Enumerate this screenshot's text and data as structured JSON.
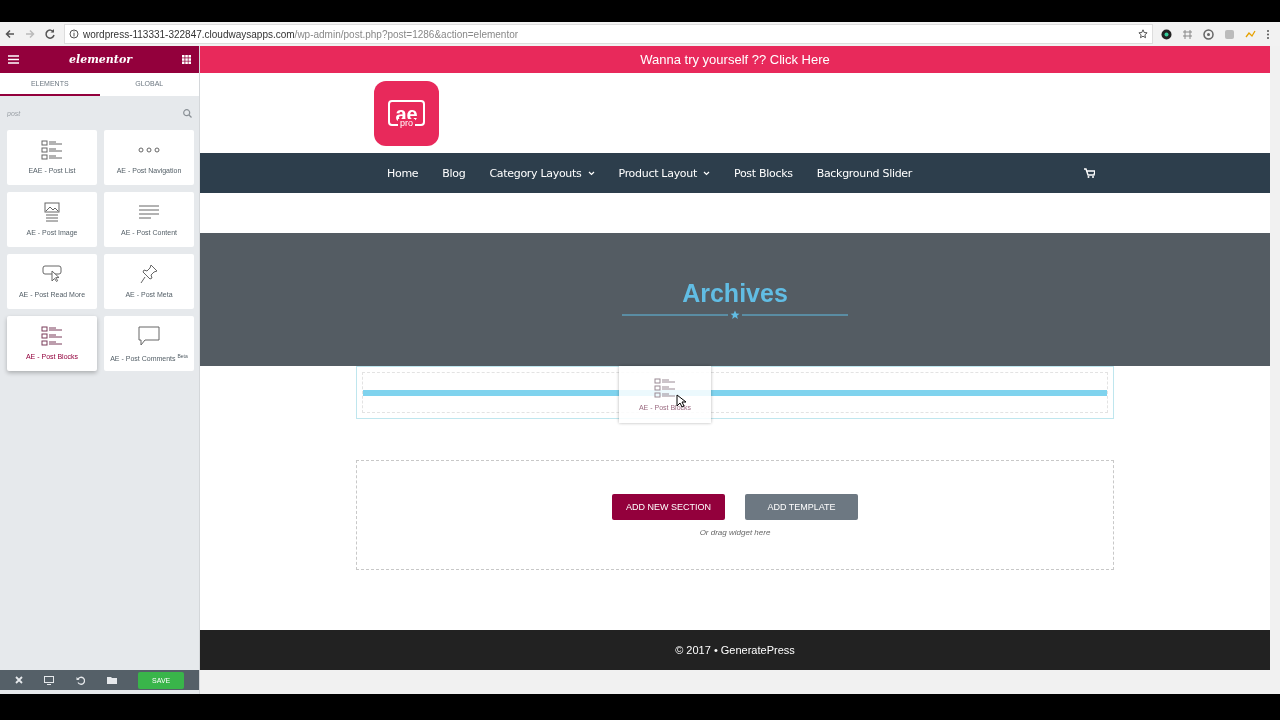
{
  "browser": {
    "url_host": "wordpress-113331-322847.cloudwaysapps.com",
    "url_path": "/wp-admin/post.php?post=1286&action=elementor"
  },
  "editor": {
    "logo": "elementor",
    "tabs": [
      {
        "label": "ELEMENTS",
        "selected": true
      },
      {
        "label": "GLOBAL",
        "selected": false
      }
    ],
    "search": {
      "value": "post"
    },
    "widgets": [
      {
        "label": "EAE - Post List",
        "kind": "list",
        "selected": false
      },
      {
        "label": "AE - Post Navigation",
        "kind": "dots",
        "selected": false
      },
      {
        "label": "AE - Post Image",
        "kind": "image",
        "selected": false
      },
      {
        "label": "AE - Post Content",
        "kind": "text",
        "selected": false
      },
      {
        "label": "AE - Post Read More",
        "kind": "button",
        "selected": false
      },
      {
        "label": "AE - Post Meta",
        "kind": "pin",
        "selected": false
      },
      {
        "label": "AE - Post Blocks",
        "kind": "list",
        "selected": true
      },
      {
        "label": "AE - Post Comments $^{Beta}$",
        "kind": "comment",
        "selected": false
      }
    ],
    "save": "SAVE"
  },
  "site": {
    "banner": "Wanna try yourself ?? Click Here",
    "logo": {
      "text": "ae",
      "sub": "pro"
    },
    "nav": [
      {
        "label": "Home",
        "dropdown": false
      },
      {
        "label": "Blog",
        "dropdown": false
      },
      {
        "label": "Category Layouts",
        "dropdown": true
      },
      {
        "label": "Product Layout",
        "dropdown": true
      },
      {
        "label": "Post Blocks",
        "dropdown": false
      },
      {
        "label": "Background Slider",
        "dropdown": false
      }
    ],
    "heading": "Archives",
    "drag_preview": "AE - Post Blocks",
    "buttons": [
      {
        "label": "ADD NEW SECTION",
        "kind": "primary"
      },
      {
        "label": "ADD TEMPLATE",
        "kind": "secondary"
      }
    ],
    "drop_hint": "Or drag widget here",
    "footer": "© 2017 • GeneratePress"
  }
}
